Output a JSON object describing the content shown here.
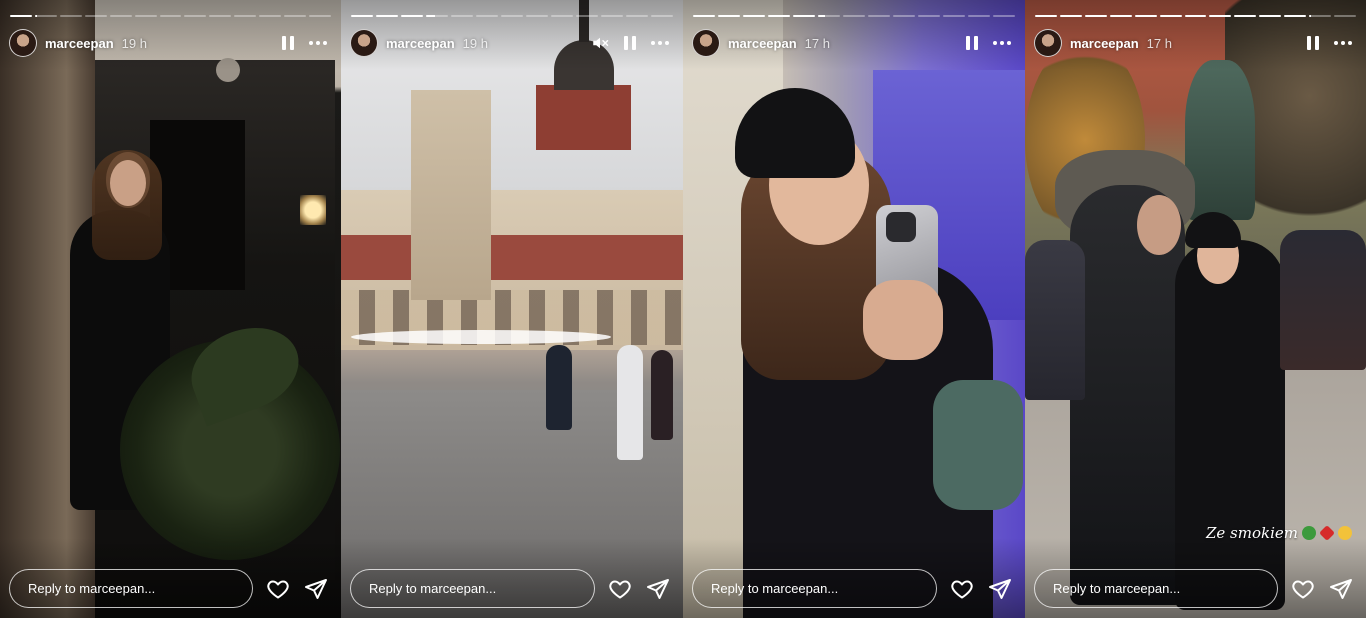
{
  "stories": [
    {
      "username": "marceepan",
      "time": "19 h",
      "reply_placeholder": "Reply to marceepan...",
      "muted": false,
      "progress": [
        1,
        0.1,
        0,
        0,
        0,
        0,
        0,
        0,
        0,
        0,
        0,
        0,
        0
      ]
    },
    {
      "username": "marceepan",
      "time": "19 h",
      "reply_placeholder": "Reply to marceepan...",
      "muted": true,
      "progress": [
        1,
        1,
        1,
        0.4,
        0,
        0,
        0,
        0,
        0,
        0,
        0,
        0,
        0
      ]
    },
    {
      "username": "marceepan",
      "time": "17 h",
      "reply_placeholder": "Reply to marceepan...",
      "muted": false,
      "progress": [
        1,
        1,
        1,
        1,
        1,
        0.3,
        0,
        0,
        0,
        0,
        0,
        0,
        0
      ]
    },
    {
      "username": "marceepan",
      "time": "17 h",
      "reply_placeholder": "Reply to marceepan...",
      "muted": false,
      "caption": "Ze smokiem",
      "progress": [
        1,
        1,
        1,
        1,
        1,
        1,
        1,
        1,
        1,
        1,
        1,
        0.1,
        0
      ]
    }
  ],
  "icons": {
    "pause": "pause-icon",
    "more": "more-icon",
    "mute": "muted-speaker-icon",
    "like": "heart-icon",
    "share": "send-icon"
  },
  "colors": {
    "text": "#ffffff",
    "reply_border": "#ffffffbf"
  }
}
